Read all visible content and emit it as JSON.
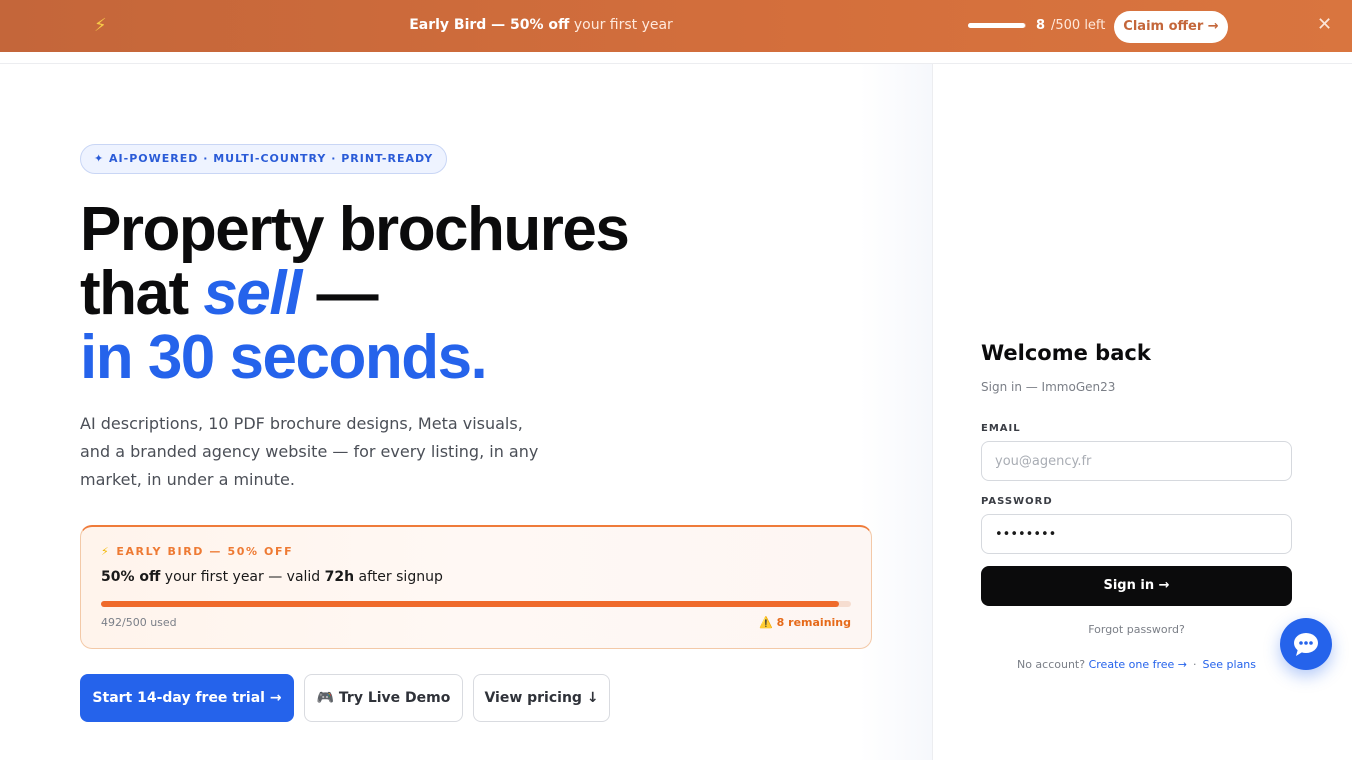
{
  "banner": {
    "icon": "lightning-icon",
    "headline_bold": "Early Bird — 50% off",
    "headline_rest": " your first year",
    "progress": 0.016,
    "remaining_count": "8",
    "remaining_suffix": "/500 left",
    "claim_label": "Claim offer →",
    "close_icon": "close-icon"
  },
  "hero": {
    "tag": "✦ AI-POWERED · MULTI-COUNTRY · PRINT-READY",
    "line1": "Property brochures",
    "line2_pre": "that ",
    "line2_em": "sell",
    "line2_post": " —",
    "line3": "in 30 seconds.",
    "subtitle": "AI descriptions, 10 PDF brochure designs, Meta visuals, and a branded agency website — for every listing, in any market, in under a minute."
  },
  "early_bird_card": {
    "kicker": "EARLY BIRD — 50% OFF",
    "kicker_icon": "⚡",
    "offer_bold": "50% off",
    "offer_mid": " your first year — valid ",
    "offer_hours": "72h",
    "offer_end": " after signup",
    "used": 492,
    "total": 500,
    "used_text": "492/500 used",
    "remaining_text": "⚠️ 8 remaining"
  },
  "cta": {
    "primary": "Start 14-day free trial →",
    "demo": "🎮 Try Live Demo",
    "pricing": "View pricing ↓"
  },
  "login": {
    "title": "Welcome back",
    "subtitle": "Sign in — ImmoGen23",
    "email_label": "EMAIL",
    "email_placeholder": "you@agency.fr",
    "password_label": "PASSWORD",
    "password_value": "••••••••",
    "submit": "Sign in →",
    "forgot": "Forgot password?",
    "no_account": "No account?",
    "create": "Create one free →",
    "separator": "·",
    "plans": "See plans"
  },
  "chat_icon": "chat-bubble-icon",
  "colors": {
    "brand_blue": "#2563eb",
    "banner_orange": "#c4663a",
    "offer_orange": "#ef6a2b"
  }
}
